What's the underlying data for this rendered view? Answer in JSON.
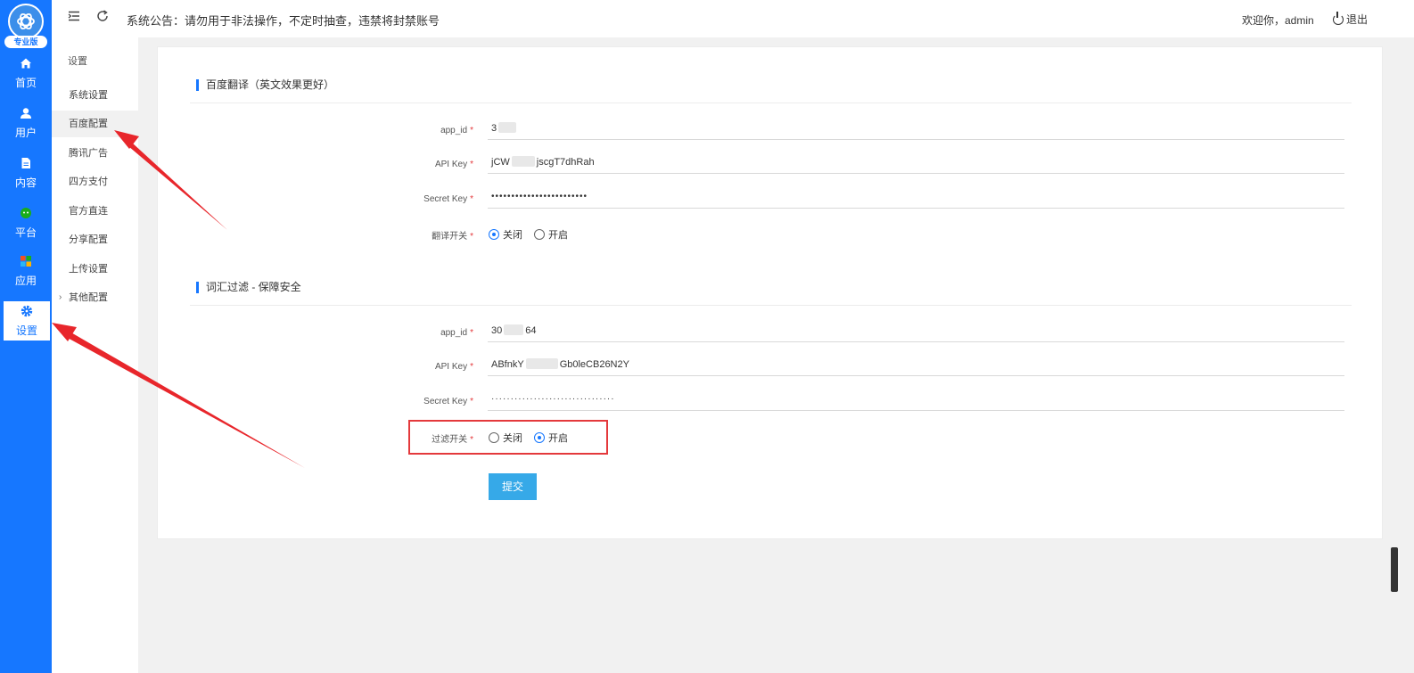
{
  "sidebar": {
    "logo_badge": "专业版",
    "items": [
      {
        "label": "首页",
        "icon": "home-icon"
      },
      {
        "label": "用户",
        "icon": "user-icon"
      },
      {
        "label": "内容",
        "icon": "document-icon"
      },
      {
        "label": "平台",
        "icon": "platform-icon"
      },
      {
        "label": "应用",
        "icon": "apps-icon"
      },
      {
        "label": "设置",
        "icon": "gear-icon"
      }
    ]
  },
  "subnav": {
    "title": "设置",
    "items": [
      "系统设置",
      "百度配置",
      "腾讯广告",
      "四方支付",
      "官方直连",
      "分享配置",
      "上传设置",
      "其他配置"
    ]
  },
  "topbar": {
    "notice": "系统公告：请勿用于非法操作，不定时抽查，违禁将封禁账号",
    "welcome": "欢迎你，admin",
    "logout": "退出"
  },
  "section1": {
    "title": "百度翻译（英文效果更好）",
    "app_id_label": "app_id",
    "app_id_value": "3",
    "api_key_label": "API Key",
    "api_key_prefix": "jCW",
    "api_key_suffix": "jscgT7dhRah",
    "secret_label": "Secret Key",
    "secret_value": "••••••••••••••••••••••••",
    "switch_label": "翻译开关",
    "off_label": "关闭",
    "on_label": "开启",
    "switch_state": "off"
  },
  "section2": {
    "title": "词汇过滤 - 保障安全",
    "app_id_label": "app_id",
    "app_id_prefix": "30",
    "app_id_suffix": "64",
    "api_key_label": "API Key",
    "api_key_prefix": "ABfnkY",
    "api_key_suffix": "Gb0leCB26N2Y",
    "secret_label": "Secret Key",
    "secret_value": "································",
    "switch_label": "过滤开关",
    "off_label": "关闭",
    "on_label": "开启",
    "switch_state": "on"
  },
  "submit_label": "提交",
  "required_mark": "*",
  "colors": {
    "primary": "#1677ff",
    "submit": "#36a9e8",
    "annotation": "#e4393c"
  }
}
